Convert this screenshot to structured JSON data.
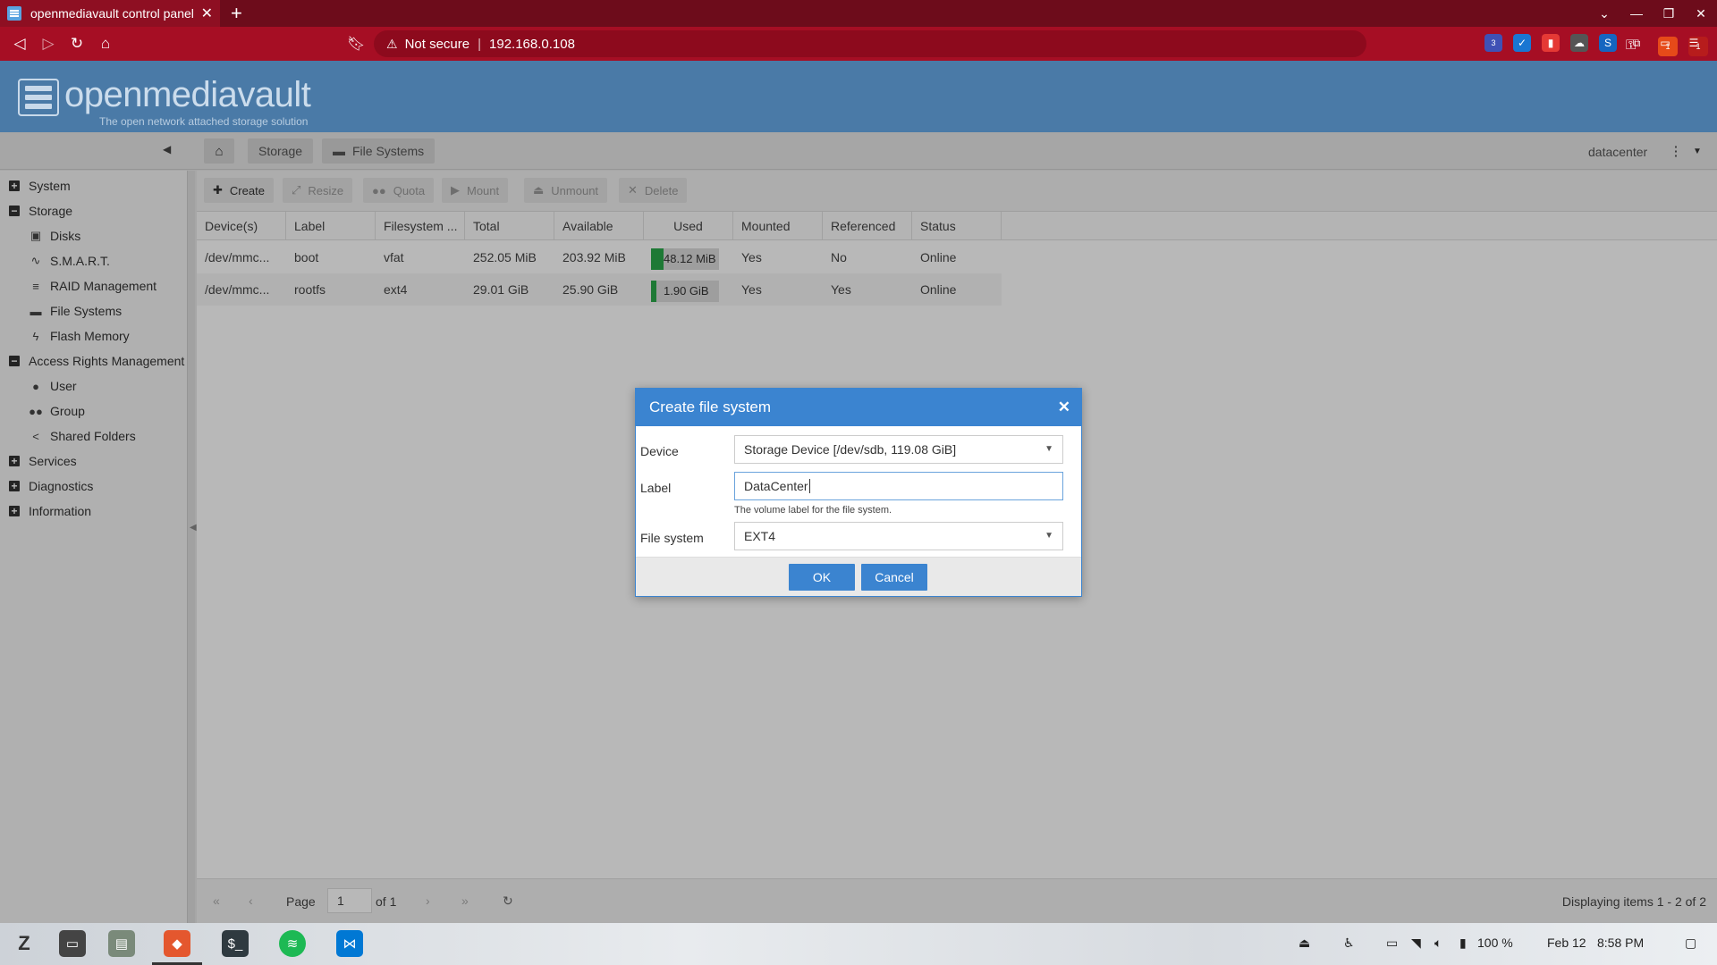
{
  "browser": {
    "tab_title": "openmediavault control panel",
    "address": "192.168.0.108",
    "security": "Not secure",
    "extension_badges": [
      "3",
      "1",
      "1"
    ]
  },
  "app": {
    "logo_title": "openmediavault",
    "logo_subtitle": "The open network attached storage solution"
  },
  "breadcrumb": {
    "items": [
      "Storage",
      "File Systems"
    ]
  },
  "header": {
    "user": "datacenter"
  },
  "sidebar": {
    "items": [
      {
        "label": "System",
        "level": 0,
        "expanded": false
      },
      {
        "label": "Storage",
        "level": 0,
        "expanded": true
      },
      {
        "label": "Disks",
        "level": 1,
        "icon": "disk-icon"
      },
      {
        "label": "S.M.A.R.T.",
        "level": 1,
        "icon": "pulse-icon"
      },
      {
        "label": "RAID Management",
        "level": 1,
        "icon": "database-icon"
      },
      {
        "label": "File Systems",
        "level": 1,
        "icon": "folder-icon"
      },
      {
        "label": "Flash Memory",
        "level": 1,
        "icon": "bolt-icon"
      },
      {
        "label": "Access Rights Management",
        "level": 0,
        "expanded": true
      },
      {
        "label": "User",
        "level": 1,
        "icon": "user-icon"
      },
      {
        "label": "Group",
        "level": 1,
        "icon": "group-icon"
      },
      {
        "label": "Shared Folders",
        "level": 1,
        "icon": "share-icon"
      },
      {
        "label": "Services",
        "level": 0,
        "expanded": false
      },
      {
        "label": "Diagnostics",
        "level": 0,
        "expanded": false
      },
      {
        "label": "Information",
        "level": 0,
        "expanded": false
      }
    ]
  },
  "toolbar": {
    "create": "Create",
    "resize": "Resize",
    "quota": "Quota",
    "mount": "Mount",
    "unmount": "Unmount",
    "delete": "Delete"
  },
  "grid": {
    "columns": [
      "Device(s)",
      "Label",
      "Filesystem ...",
      "Total",
      "Available",
      "Used",
      "Mounted",
      "Referenced",
      "Status"
    ],
    "rows": [
      {
        "device": "/dev/mmc...",
        "label": "boot",
        "fs": "vfat",
        "total": "252.05 MiB",
        "available": "203.92 MiB",
        "used": "48.12 MiB",
        "used_fraction": 0.19,
        "mounted": "Yes",
        "referenced": "No",
        "status": "Online"
      },
      {
        "device": "/dev/mmc...",
        "label": "rootfs",
        "fs": "ext4",
        "total": "29.01 GiB",
        "available": "25.90 GiB",
        "used": "1.90 GiB",
        "used_fraction": 0.07,
        "mounted": "Yes",
        "referenced": "Yes",
        "status": "Online"
      }
    ]
  },
  "pager": {
    "page_label": "Page",
    "page_value": "1",
    "of_label": "of 1",
    "display": "Displaying items 1 - 2 of 2"
  },
  "dialog": {
    "title": "Create file system",
    "device_label": "Device",
    "device_value": "Storage Device [/dev/sdb, 119.08 GiB]",
    "label_label": "Label",
    "label_value": "DataCenter",
    "label_hint": "The volume label for the file system.",
    "fs_label": "File system",
    "fs_value": "EXT4",
    "ok": "OK",
    "cancel": "Cancel"
  },
  "taskbar": {
    "volume": "100 %",
    "date": "Feb 12",
    "time": "8:58 PM"
  }
}
